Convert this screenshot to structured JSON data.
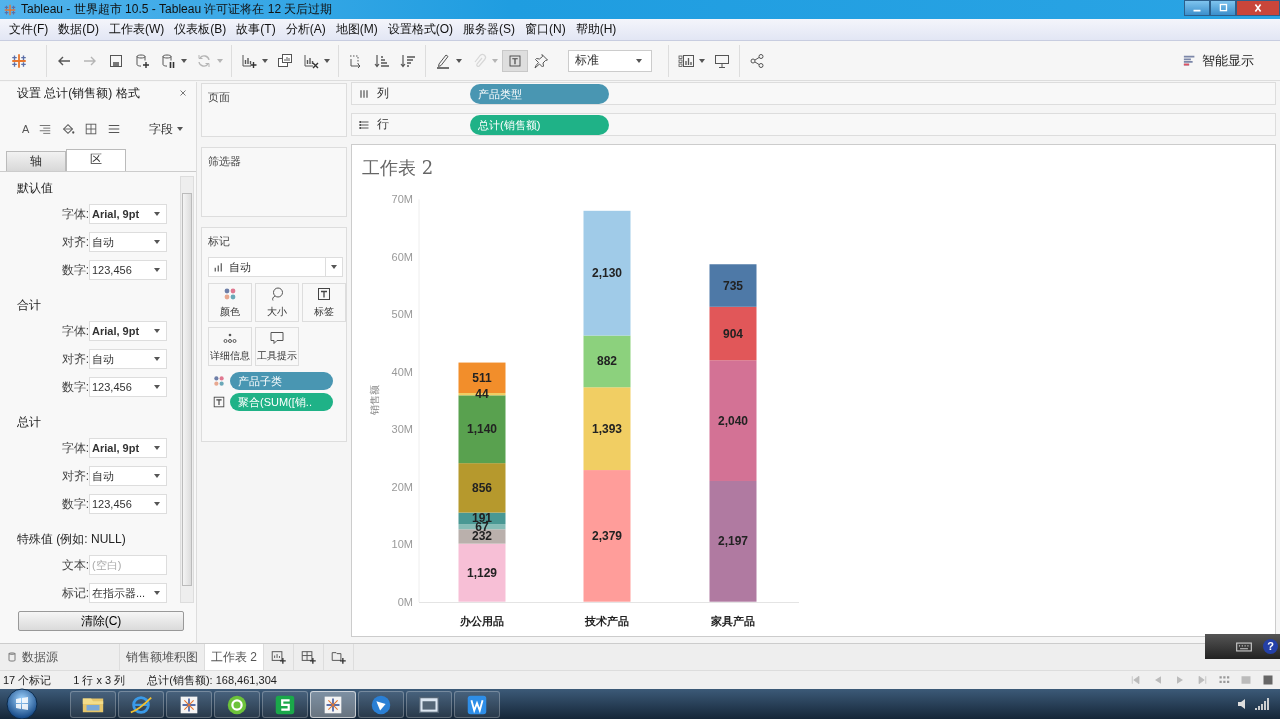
{
  "window": {
    "title": "Tableau - 世界超市 10.5 - Tableau 许可证将在 12 天后过期"
  },
  "menu": [
    "文件(F)",
    "数据(D)",
    "工作表(W)",
    "仪表板(B)",
    "故事(T)",
    "分析(A)",
    "地图(M)",
    "设置格式(O)",
    "服务器(S)",
    "窗口(N)",
    "帮助(H)"
  ],
  "toolbar": {
    "buttons": [
      {
        "disabled": false,
        "pressed": false
      },
      {
        "disabled": true,
        "pressed": false
      },
      {
        "disabled": false,
        "pressed": false
      },
      {
        "disabled": false,
        "pressed": false
      },
      {
        "disabled": false,
        "pressed": false
      },
      {
        "disabled": true,
        "pressed": false
      },
      {
        "disabled": false,
        "pressed": false
      },
      {
        "disabled": false,
        "pressed": false
      },
      {
        "disabled": false,
        "pressed": false
      },
      {
        "disabled": false,
        "pressed": false
      },
      {
        "disabled": false,
        "pressed": false
      },
      {
        "disabled": false,
        "pressed": false
      },
      {
        "disabled": false,
        "pressed": false
      },
      {
        "disabled": true,
        "pressed": false
      },
      {
        "disabled": false,
        "pressed": true
      },
      {
        "disabled": false,
        "pressed": false
      },
      {
        "disabled": false,
        "pressed": false
      },
      {
        "disabled": false,
        "pressed": false
      },
      {
        "disabled": false,
        "pressed": false
      }
    ],
    "style_select": {
      "value": "标准"
    },
    "show_me": {
      "label": "智能显示"
    }
  },
  "format_panel": {
    "title": "设置 总计(销售额) 格式",
    "font_tool": "A",
    "fields_menu": "字段",
    "tabs": [
      {
        "label": "轴",
        "selected": false
      },
      {
        "label": "区",
        "selected": true
      }
    ],
    "sections": [
      {
        "title": "默认值",
        "rows": [
          {
            "label": "字体:",
            "kind": "dropdown",
            "value": "Arial, 9pt",
            "bold": true
          },
          {
            "label": "对齐:",
            "kind": "dropdown",
            "value": "自动",
            "bold": false
          },
          {
            "label": "数字:",
            "kind": "dropdown",
            "value": "123,456",
            "bold": false
          }
        ]
      },
      {
        "title": "合计",
        "rows": [
          {
            "label": "字体:",
            "kind": "dropdown",
            "value": "Arial, 9pt",
            "bold": true
          },
          {
            "label": "对齐:",
            "kind": "dropdown",
            "value": "自动",
            "bold": false
          },
          {
            "label": "数字:",
            "kind": "dropdown",
            "value": "123,456",
            "bold": false
          }
        ]
      },
      {
        "title": "总计",
        "rows": [
          {
            "label": "字体:",
            "kind": "dropdown",
            "value": "Arial, 9pt",
            "bold": true
          },
          {
            "label": "对齐:",
            "kind": "dropdown",
            "value": "自动",
            "bold": false
          },
          {
            "label": "数字:",
            "kind": "dropdown",
            "value": "123,456",
            "bold": false
          }
        ]
      },
      {
        "title": "特殊值 (例如: NULL)",
        "rows": [
          {
            "label": "文本:",
            "kind": "field",
            "placeholder": "(空白)"
          },
          {
            "label": "标记:",
            "kind": "dropdown",
            "value": "在指示器...",
            "bold": false
          }
        ]
      }
    ],
    "clear_button": "清除(C)"
  },
  "cards": {
    "pages": {
      "title": "页面"
    },
    "filters": {
      "title": "筛选器"
    },
    "marks": {
      "title": "标记",
      "mark_type": "自动",
      "buttons": [
        {
          "label": "颜色"
        },
        {
          "label": "大小"
        },
        {
          "label": "标签"
        },
        {
          "label": "详细信息"
        },
        {
          "label": "工具提示"
        }
      ],
      "pills": [
        {
          "label": "产品子类",
          "kind": "dimension"
        },
        {
          "label": "聚合(SUM([销..",
          "kind": "measure"
        }
      ]
    }
  },
  "shelves": [
    {
      "label": "列",
      "kind": "columns",
      "pills": [
        {
          "label": "产品类型",
          "kind": "dimension"
        }
      ]
    },
    {
      "label": "行",
      "kind": "rows",
      "pills": [
        {
          "label": "总计(销售额)",
          "kind": "measure"
        }
      ]
    }
  ],
  "view": {
    "title": "工作表 2",
    "chart_data": {
      "type": "bar",
      "stacked": true,
      "orientation": "vertical",
      "ylabel": "销售额",
      "categories": [
        "办公用品",
        "技术产品",
        "家具产品"
      ],
      "ylim": [
        0,
        70
      ],
      "yticks": [
        {
          "value": 0,
          "label": "0M"
        },
        {
          "value": 10,
          "label": "10M"
        },
        {
          "value": 20,
          "label": "20M"
        },
        {
          "value": 30,
          "label": "30M"
        },
        {
          "value": 40,
          "label": "40M"
        },
        {
          "value": 50,
          "label": "50M"
        },
        {
          "value": 60,
          "label": "60M"
        },
        {
          "value": 70,
          "label": "70M"
        }
      ],
      "series": [
        {
          "color": "#f7bfd6",
          "values": [
            10.1,
            null,
            null
          ]
        },
        {
          "color": "#bab0ac",
          "values": [
            2.5,
            null,
            null
          ]
        },
        {
          "color": "#86bcb6",
          "values": [
            0.9,
            null,
            null
          ]
        },
        {
          "color": "#499894",
          "values": [
            2.0,
            null,
            null
          ]
        },
        {
          "color": "#b6992d",
          "values": [
            8.6,
            null,
            null
          ]
        },
        {
          "color": "#59a14f",
          "values": [
            11.8,
            null,
            null
          ]
        },
        {
          "color": "#f1ce63",
          "values": [
            0.4,
            null,
            null
          ]
        },
        {
          "color": "#f28e2b",
          "values": [
            5.3,
            null,
            null
          ]
        },
        {
          "color": "#ff9d9a",
          "values": [
            null,
            22.9,
            null
          ]
        },
        {
          "color": "#f1ce63",
          "values": [
            null,
            14.4,
            null
          ]
        },
        {
          "color": "#8cd17d",
          "values": [
            null,
            9.0,
            null
          ]
        },
        {
          "color": "#a0cbe8",
          "values": [
            null,
            21.7,
            null
          ]
        },
        {
          "color": "#b07aa1",
          "values": [
            null,
            null,
            21.0
          ]
        },
        {
          "color": "#d37295",
          "values": [
            null,
            null,
            21.0
          ]
        },
        {
          "color": "#e15759",
          "values": [
            null,
            null,
            9.3
          ]
        },
        {
          "color": "#4e79a7",
          "values": [
            null,
            null,
            7.4
          ]
        }
      ],
      "value_labels": [
        [
          "1,129",
          null,
          null
        ],
        [
          "232",
          null,
          null
        ],
        [
          "67",
          null,
          null
        ],
        [
          "191",
          null,
          null
        ],
        [
          "856",
          null,
          null
        ],
        [
          "1,140",
          null,
          null
        ],
        [
          "44",
          null,
          null
        ],
        [
          "511",
          null,
          null
        ],
        [
          null,
          "2,379",
          null
        ],
        [
          null,
          "1,393",
          null
        ],
        [
          null,
          "882",
          null
        ],
        [
          null,
          "2,130",
          null
        ],
        [
          null,
          null,
          "2,197"
        ],
        [
          null,
          null,
          "2,040"
        ],
        [
          null,
          null,
          "904"
        ],
        [
          null,
          null,
          "735"
        ]
      ]
    }
  },
  "sheet_tabs": [
    {
      "label": "数据源",
      "kind": "datasource",
      "selected": false
    },
    {
      "label": "销售额堆积图",
      "kind": "sheet",
      "selected": false
    },
    {
      "label": "工作表 2",
      "kind": "sheet",
      "selected": true
    }
  ],
  "status_bar": [
    "17 个标记",
    "1 行 x 3 列",
    "总计(销售额): 168,461,304"
  ],
  "ime_bar": {
    "help": "?"
  },
  "taskbar": {
    "apps": [
      {
        "selected": false
      },
      {
        "selected": false
      },
      {
        "selected": false
      },
      {
        "selected": false
      },
      {
        "selected": false
      },
      {
        "selected": true
      },
      {
        "selected": false
      },
      {
        "selected": false
      },
      {
        "selected": false
      }
    ]
  }
}
